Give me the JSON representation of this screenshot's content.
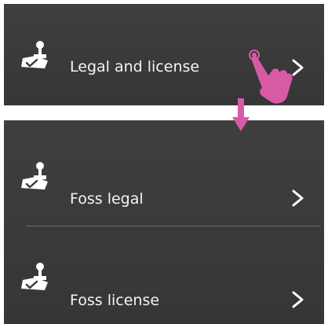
{
  "menu_before": {
    "items": [
      {
        "label": "Legal and license",
        "icon": "stamp-icon",
        "chevron": "chevron-right-icon"
      }
    ]
  },
  "menu_after": {
    "items": [
      {
        "label": "Foss legal",
        "icon": "stamp-icon",
        "chevron": "chevron-right-icon"
      },
      {
        "label": "Foss license",
        "icon": "stamp-icon",
        "chevron": "chevron-right-icon"
      }
    ]
  },
  "annotations": {
    "tap_gesture_icon": "tap-hand-icon",
    "transition_icon": "arrow-down-icon",
    "accent_color": "#d85aa5"
  },
  "colors": {
    "panel_background": "#3a3a3a",
    "text": "#f4f4f4",
    "divider": "#6a6a6a"
  }
}
